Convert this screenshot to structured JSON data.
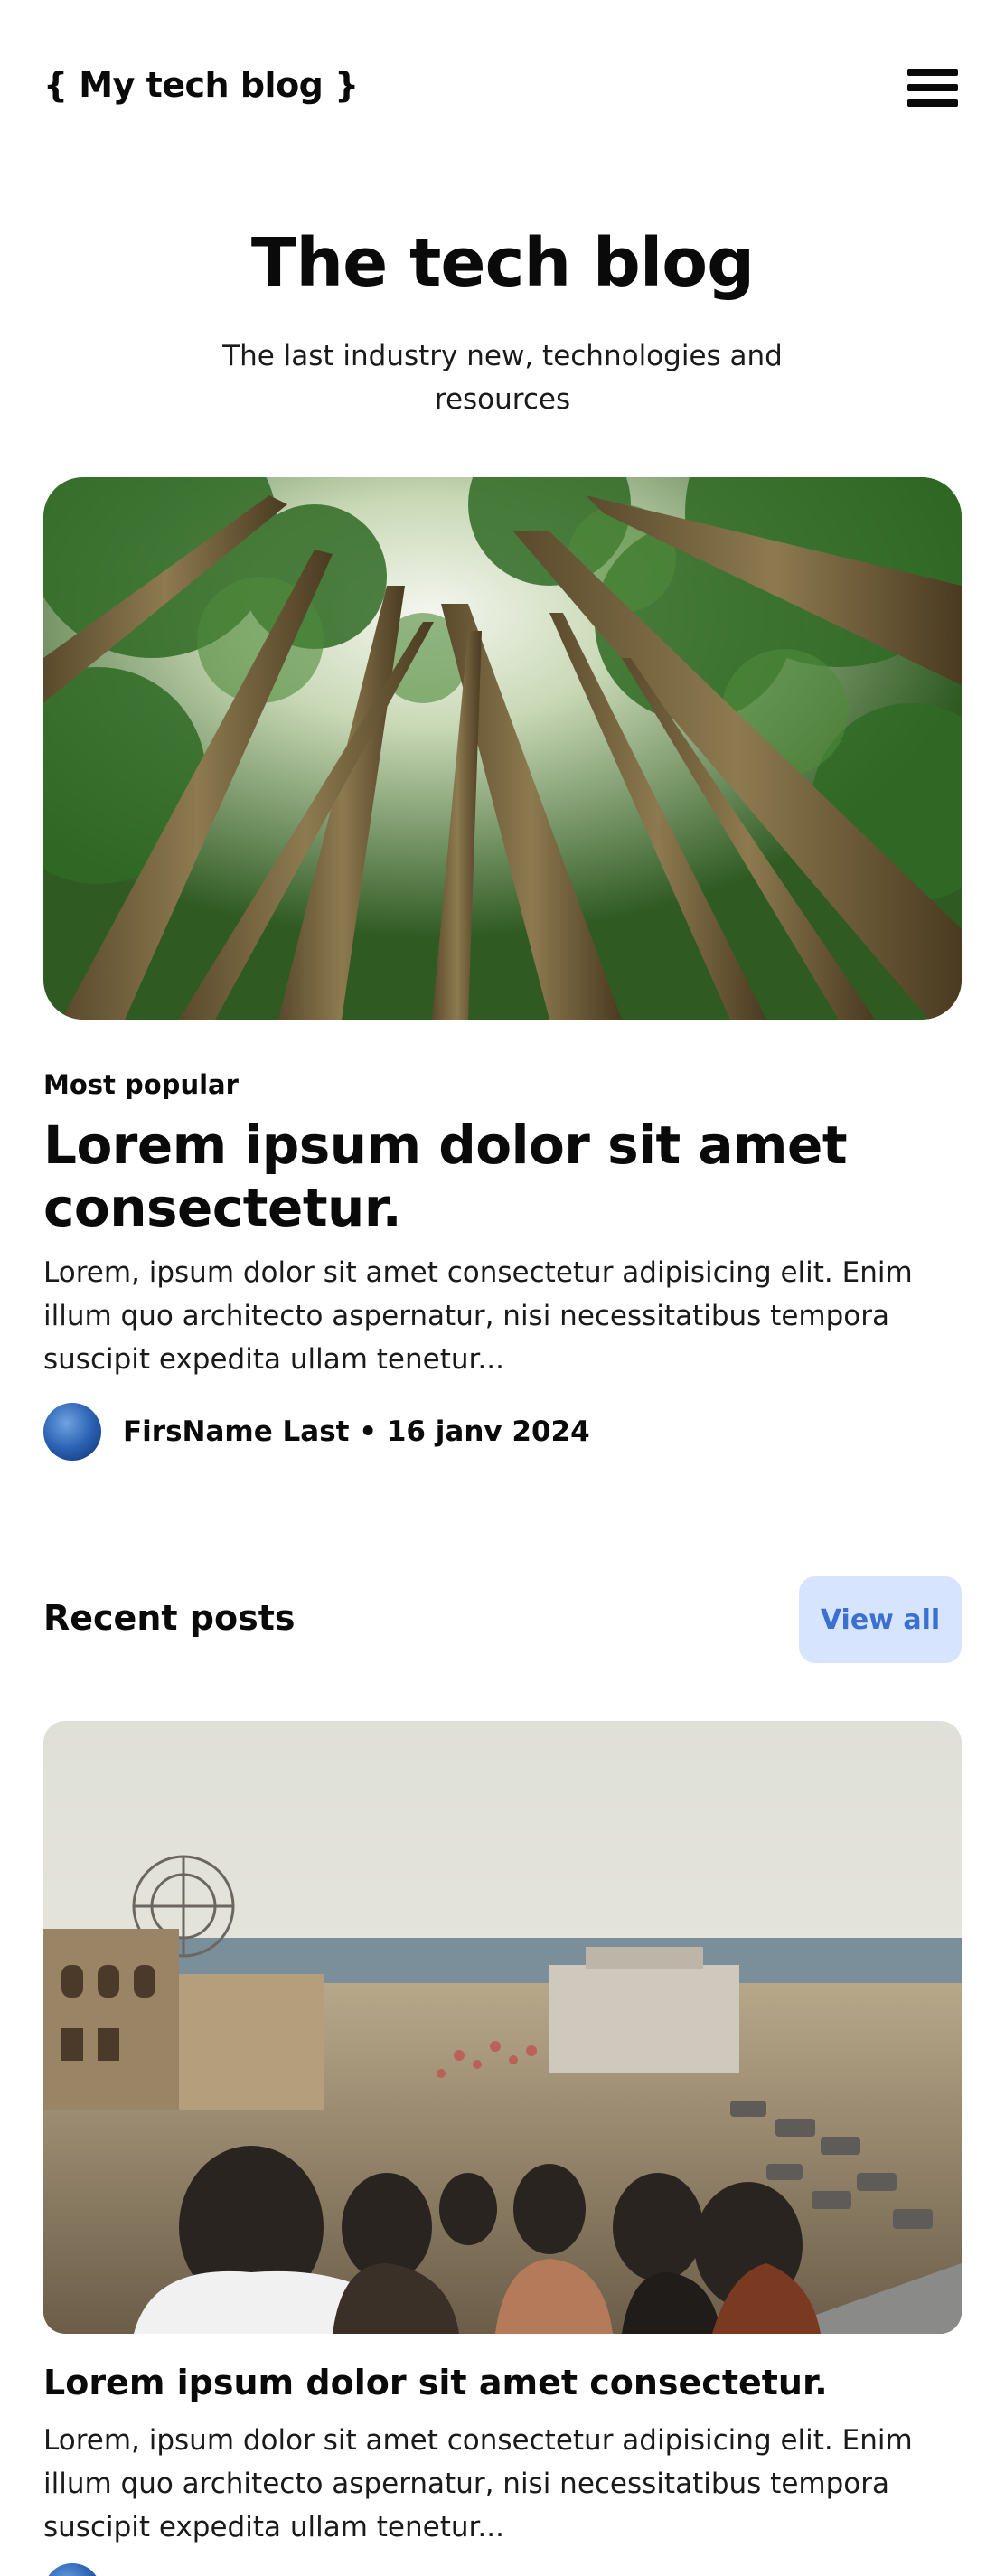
{
  "header": {
    "logo": "{ My tech blog }",
    "menu_icon": "hamburger-menu-icon"
  },
  "hero": {
    "title": "The tech blog",
    "subtitle": "The last industry new, technologies and resources"
  },
  "featured": {
    "tag": "Most popular",
    "title": "Lorem ipsum dolor sit amet consectetur.",
    "excerpt": "Lorem, ipsum dolor sit amet consectetur adipisicing elit. Enim illum quo architecto aspernatur, nisi necessitatibus tempora suscipit expedita ullam tenetur...",
    "author": "FirsName Last",
    "date": "16 janv 2024",
    "byline": "FirsName Last • 16 janv 2024"
  },
  "recent": {
    "section_title": "Recent posts",
    "view_all_label": "View all",
    "posts": [
      {
        "title": "Lorem ipsum dolor sit amet consectetur.",
        "excerpt": "Lorem, ipsum dolor sit amet consectetur adipisicing elit. Enim illum quo architecto aspernatur, nisi necessitatibus tempora suscipit expedita ullam tenetur..."
      }
    ]
  },
  "colors": {
    "text": "#0a0a0a",
    "button_bg": "#d6e4fe",
    "button_text": "#3b6fd0"
  }
}
